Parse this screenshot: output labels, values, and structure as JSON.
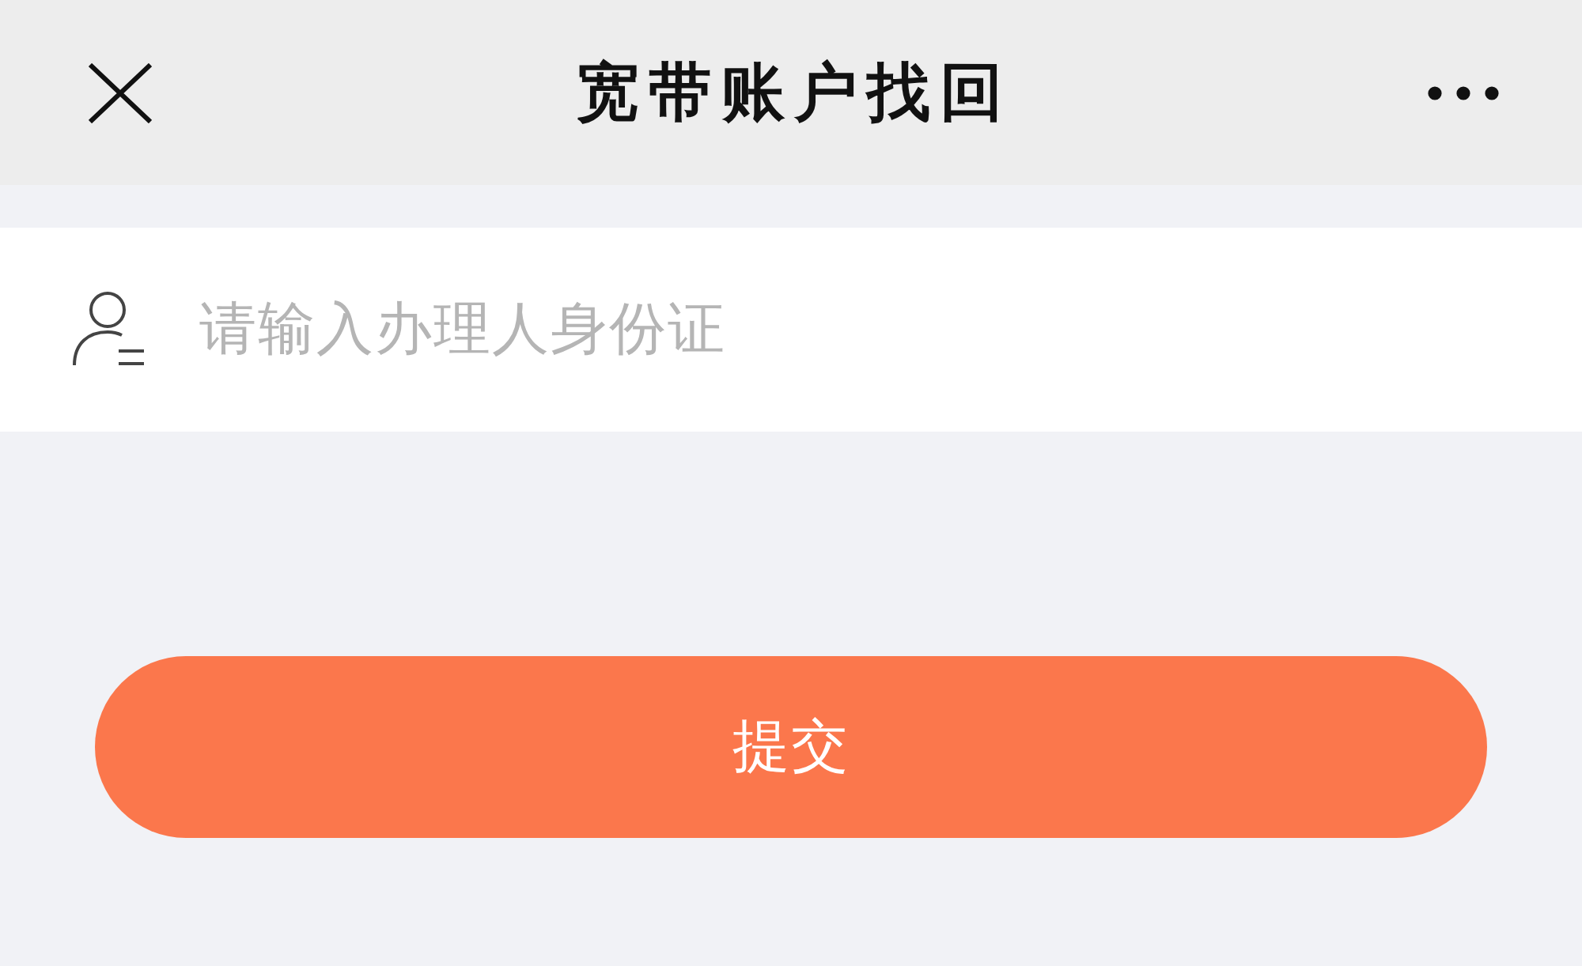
{
  "header": {
    "title": "宽带账户找回"
  },
  "form": {
    "id_field": {
      "placeholder": "请输入办理人身份证"
    }
  },
  "submit_button": {
    "label": "提交"
  }
}
